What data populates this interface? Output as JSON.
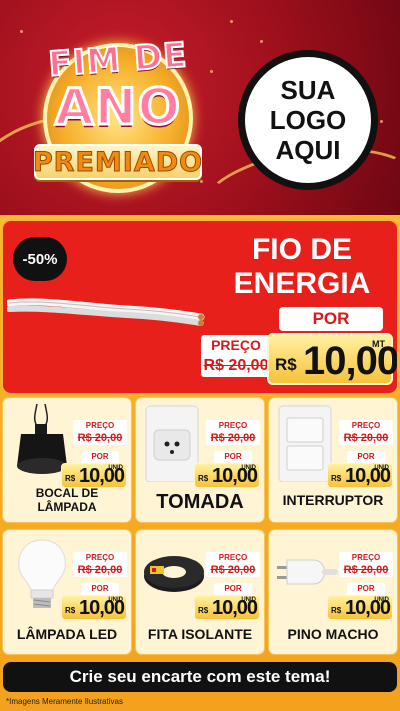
{
  "header": {
    "title_line1": "FIM DE",
    "title_line2": "ANO",
    "title_line3": "PREMIADO",
    "logo_lines": [
      "SUA",
      "LOGO",
      "AQUI"
    ]
  },
  "feature": {
    "discount": "-50%",
    "title_line1": "FIO DE",
    "title_line2": "ENERGIA",
    "por_label": "POR",
    "preco_label": "PREÇO",
    "old_price": "R$ 20,00",
    "currency": "R$",
    "price": "10,00",
    "unit": "MT"
  },
  "products": [
    {
      "name": "BOCAL DE LÂMPADA",
      "preco_label": "PREÇO",
      "old_price": "R$ 20,00",
      "por_label": "POR",
      "currency": "R$",
      "price": "10,00",
      "unit": "UNID"
    },
    {
      "name": "TOMADA",
      "preco_label": "PREÇO",
      "old_price": "R$ 20,00",
      "por_label": "POR",
      "currency": "R$",
      "price": "10,00",
      "unit": "UNID"
    },
    {
      "name": "INTERRUPTOR",
      "preco_label": "PREÇO",
      "old_price": "R$ 20,00",
      "por_label": "POR",
      "currency": "R$",
      "price": "10,00",
      "unit": "UNID"
    },
    {
      "name": "LÂMPADA LED",
      "preco_label": "PREÇO",
      "old_price": "R$ 20,00",
      "por_label": "POR",
      "currency": "R$",
      "price": "10,00",
      "unit": "UNID"
    },
    {
      "name": "FITA ISOLANTE",
      "preco_label": "PREÇO",
      "old_price": "R$ 20,00",
      "por_label": "POR",
      "currency": "R$",
      "price": "10,00",
      "unit": "UNID"
    },
    {
      "name": "PINO MACHO",
      "preco_label": "PREÇO",
      "old_price": "R$ 20,00",
      "por_label": "POR",
      "currency": "R$",
      "price": "10,00",
      "unit": "UNID"
    }
  ],
  "cta": "Crie seu encarte com este tema!",
  "disclaimer": "*Imagens Meramente Ilustrativas",
  "colors": {
    "header_red": "#9c0f1c",
    "feature_red": "#e8201c",
    "gold": "#f6c23a",
    "background": "#f8b42a"
  }
}
